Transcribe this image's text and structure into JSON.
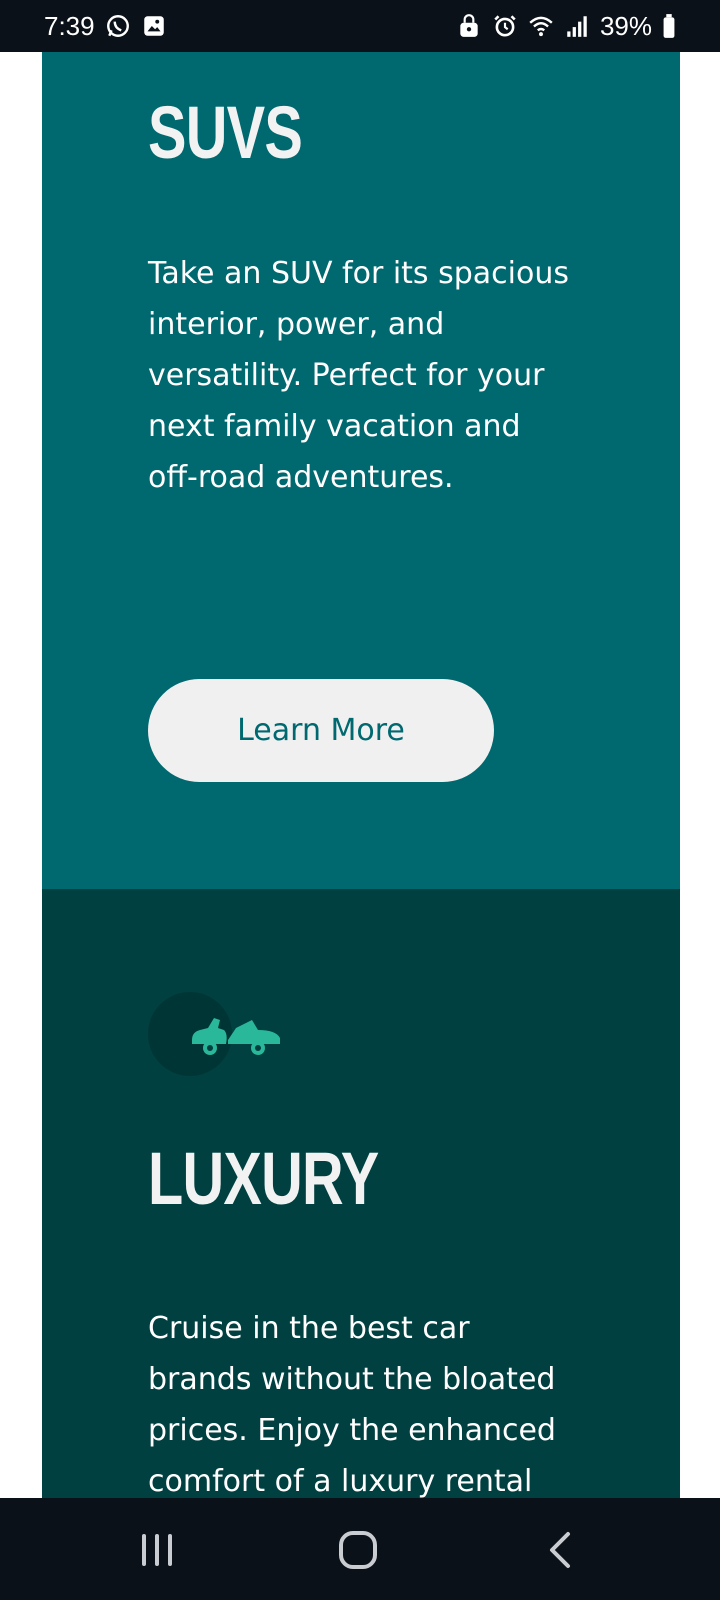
{
  "status_bar": {
    "time": "7:39",
    "battery_percent": "39%",
    "left_icons": [
      "whatsapp-icon",
      "image-icon"
    ],
    "right_icons": [
      "lock-icon",
      "alarm-icon",
      "wifi-icon",
      "signal-icon",
      "battery-icon"
    ]
  },
  "sections": [
    {
      "title": "SUVS",
      "description": "Take an SUV for its spacious interior, power, and versatility. Perfect for your next family vacation and off-road adventures.",
      "button_label": "Learn More",
      "background": "#006970"
    },
    {
      "icon": "luxury-car-icon",
      "title": "LUXURY",
      "description": "Cruise in the best car brands without the bloated prices. Enjoy the enhanced comfort of a luxury rental",
      "background": "#004040",
      "icon_color": "#2ab89a"
    }
  ],
  "nav_bar": {
    "buttons": [
      "recent-apps-icon",
      "home-icon",
      "back-icon"
    ]
  }
}
